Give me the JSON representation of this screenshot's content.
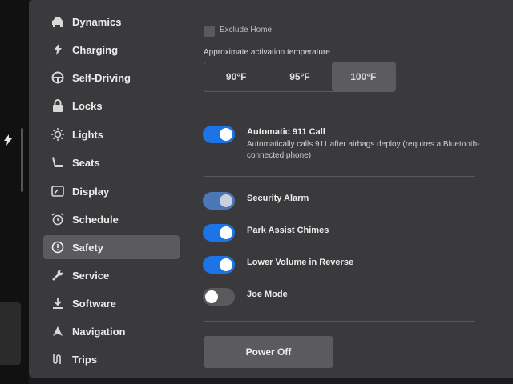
{
  "sidebar": {
    "items": [
      {
        "label": "Dynamics",
        "icon": "car-icon"
      },
      {
        "label": "Charging",
        "icon": "bolt-icon"
      },
      {
        "label": "Self-Driving",
        "icon": "steering-wheel-icon"
      },
      {
        "label": "Locks",
        "icon": "lock-icon"
      },
      {
        "label": "Lights",
        "icon": "sun-icon"
      },
      {
        "label": "Seats",
        "icon": "seat-icon"
      },
      {
        "label": "Display",
        "icon": "display-icon"
      },
      {
        "label": "Schedule",
        "icon": "alarm-clock-icon"
      },
      {
        "label": "Safety",
        "icon": "info-circle-icon",
        "active": true
      },
      {
        "label": "Service",
        "icon": "wrench-icon"
      },
      {
        "label": "Software",
        "icon": "download-icon"
      },
      {
        "label": "Navigation",
        "icon": "navigation-arrow-icon"
      },
      {
        "label": "Trips",
        "icon": "trips-icon"
      }
    ]
  },
  "main": {
    "exclude_home_label": "Exclude Home",
    "activation_temp_label": "Approximate activation temperature",
    "temp_options": [
      "90°F",
      "95°F",
      "100°F"
    ],
    "temp_selected": "100°F",
    "toggles": [
      {
        "title": "Automatic 911 Call",
        "description": "Automatically calls 911 after airbags deploy (requires a Bluetooth-connected phone)",
        "state": "on"
      },
      {
        "title": "Security Alarm",
        "state": "on-disabled"
      },
      {
        "title": "Park Assist Chimes",
        "state": "on"
      },
      {
        "title": "Lower Volume in Reverse",
        "state": "on"
      },
      {
        "title": "Joe Mode",
        "state": "off"
      }
    ],
    "power_off_label": "Power Off"
  },
  "colors": {
    "accent": "#1d74e6",
    "background": "#3a3a3c",
    "selected": "#5b5b5e"
  }
}
